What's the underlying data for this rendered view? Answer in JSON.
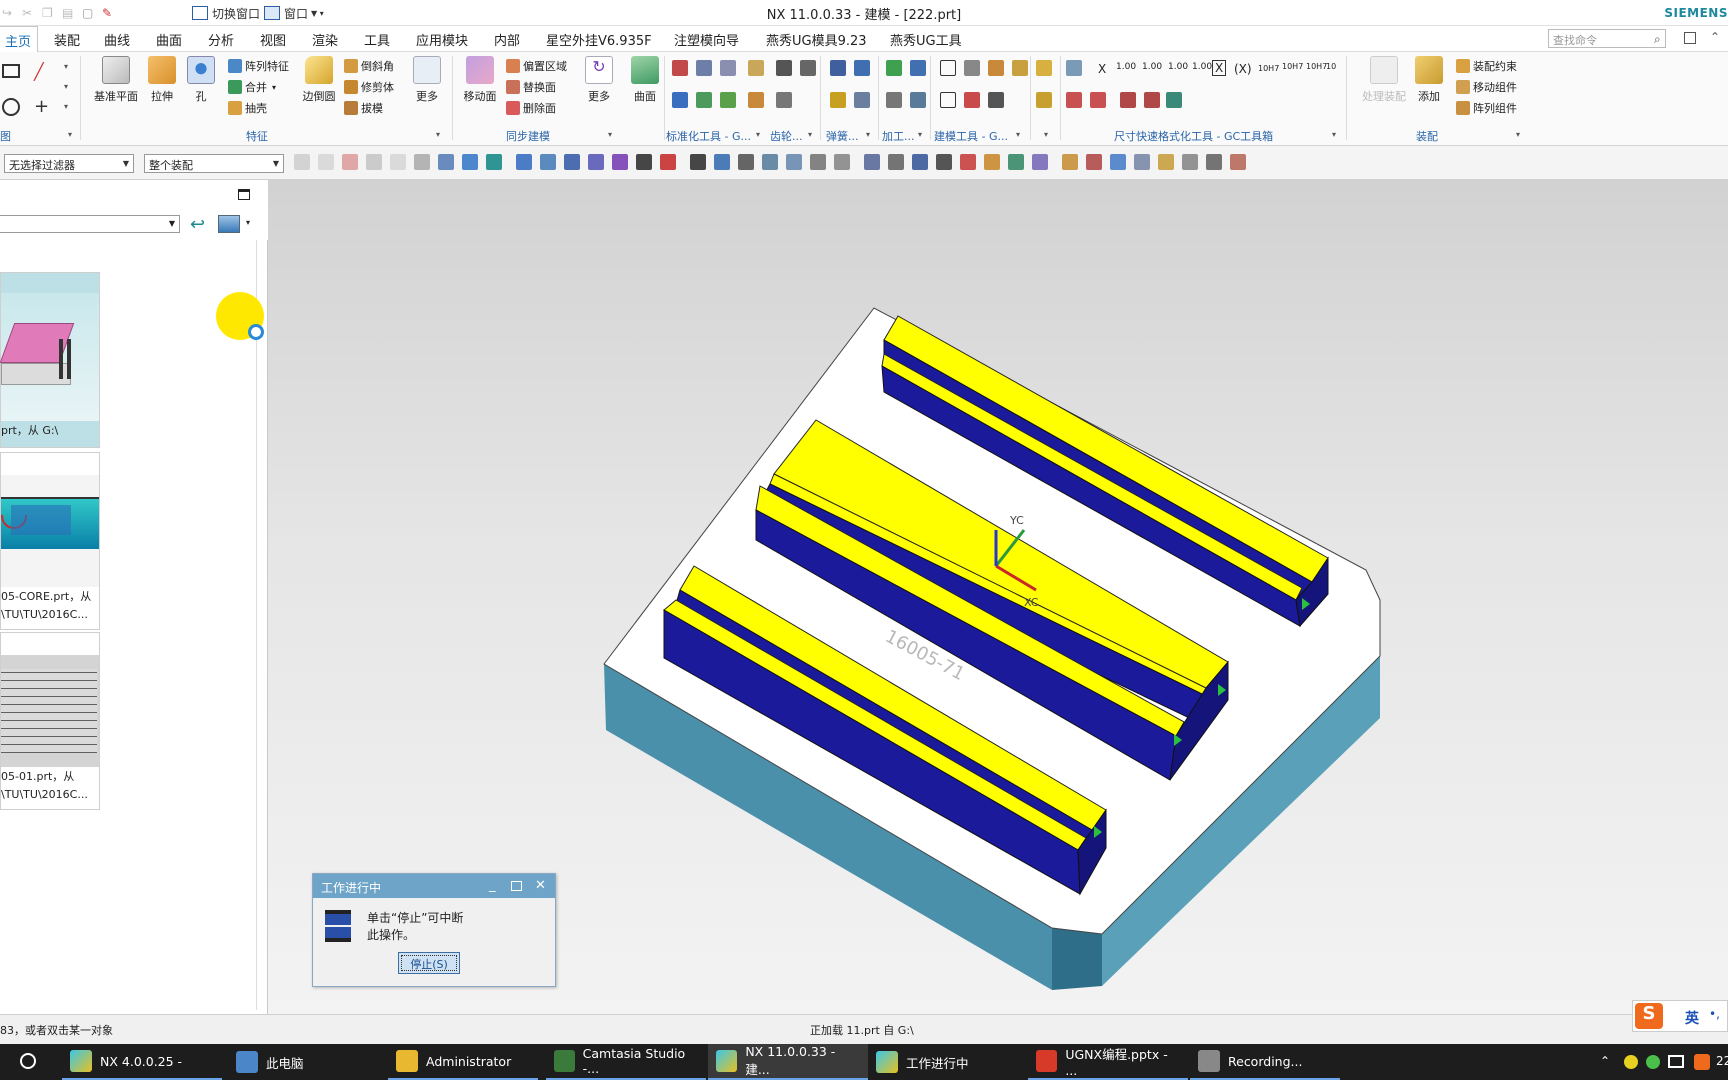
{
  "title_bar": {
    "quick_access": [
      "切换窗口",
      "窗口"
    ],
    "title": "NX 11.0.0.33 - 建模 - [222.prt]",
    "brand": "SIEMENS"
  },
  "menu": {
    "items": [
      "主页",
      "装配",
      "曲线",
      "曲面",
      "分析",
      "视图",
      "渲染",
      "工具",
      "应用模块",
      "内部",
      "星空外挂V6.935F",
      "注塑模向导",
      "燕秀UG模具9.23",
      "燕秀UG工具"
    ],
    "active": "主页",
    "search_placeholder": "查找命令"
  },
  "ribbon": {
    "groups": {
      "sketch": "图",
      "feature": "特征",
      "sync": "同步建模",
      "standard": "标准化工具 - G...",
      "gear": "齿轮...",
      "spring": "弹簧...",
      "machining": "加工...",
      "modeling_tools": "建模工具 - G...",
      "dimension": "尺寸快速格式化工具 - GC工具箱",
      "assembly": "装配"
    },
    "feature_buttons": {
      "datum": "基准平面",
      "extrude": "拉伸",
      "hole": "孔",
      "pattern": "阵列特征",
      "unite": "合并",
      "shell": "抽壳",
      "edge_blend": "边倒圆",
      "chamfer": "倒斜角",
      "trim": "修剪体",
      "draft": "拔模",
      "more": "更多"
    },
    "sync_buttons": {
      "move_face": "移动面",
      "offset_region": "偏置区域",
      "replace_face": "替换面",
      "delete_face": "删除面",
      "more": "更多",
      "surface": "曲面"
    },
    "assembly_buttons": {
      "process": "处理装配",
      "add": "添加",
      "constraint": "装配约束",
      "move_component": "移动组件",
      "pattern_component": "阵列组件"
    },
    "dimension_labels": [
      "X",
      "1.00",
      "1.00",
      "1.00",
      "1.00",
      "X",
      "(X)",
      "10H7",
      "10H7",
      "10H7",
      "10"
    ]
  },
  "selection_bar": {
    "type_filter": "无选择过滤器",
    "scope": "整个装配"
  },
  "history_panel": {
    "items": [
      {
        "caption_1": "prt，从 G:\\",
        "caption_2": ""
      },
      {
        "caption_1": "05-CORE.prt，从",
        "caption_2": "\\TU\\TU\\2016C..."
      },
      {
        "caption_1": "05-01.prt，从",
        "caption_2": "\\TU\\TU\\2016C..."
      }
    ]
  },
  "viewport": {
    "axis_labels": {
      "y": "YC",
      "x": "XC"
    },
    "watermark": "16005-71"
  },
  "dialog": {
    "title": "工作进行中",
    "message_line1": "单击“停止”可中断",
    "message_line2": "此操作。",
    "stop_button": "停止(S)"
  },
  "status": {
    "left": "83，或者双击某一对象",
    "center": "正加载 11.prt 自 G:\\"
  },
  "taskbar": {
    "items": [
      "NX 4.0.0.25 -",
      "此电脑",
      "Administrator",
      "Camtasia Studio -...",
      "NX 11.0.0.33 - 建...",
      "工作进行中",
      "UGNX编程.pptx - ...",
      "Recording..."
    ],
    "ime": "英",
    "clock": "22"
  },
  "colors": {
    "accent": "#1a6fb5",
    "yellow_face": "#ffff00",
    "blue_face": "#1a1a9a",
    "plate_side": "#4b90aa"
  }
}
